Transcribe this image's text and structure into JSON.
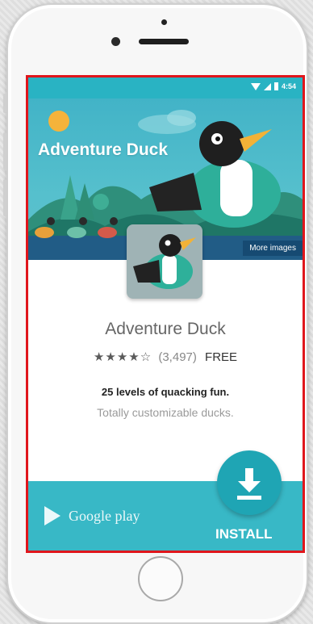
{
  "status_bar": {
    "time": "4:54"
  },
  "hero": {
    "title": "Adventure Duck",
    "more_images_label": "More images"
  },
  "app": {
    "name": "Adventure Duck",
    "stars": "★★★★☆",
    "rating_count": "(3,497)",
    "price": "FREE",
    "tagline": "25 levels of quacking fun.",
    "subline": "Totally customizable ducks."
  },
  "footer": {
    "store_name": "Google play",
    "install_label": "INSTALL"
  },
  "colors": {
    "frame_highlight": "#e0161c",
    "teal": "#29b3c3",
    "install": "#1fa5b4"
  }
}
